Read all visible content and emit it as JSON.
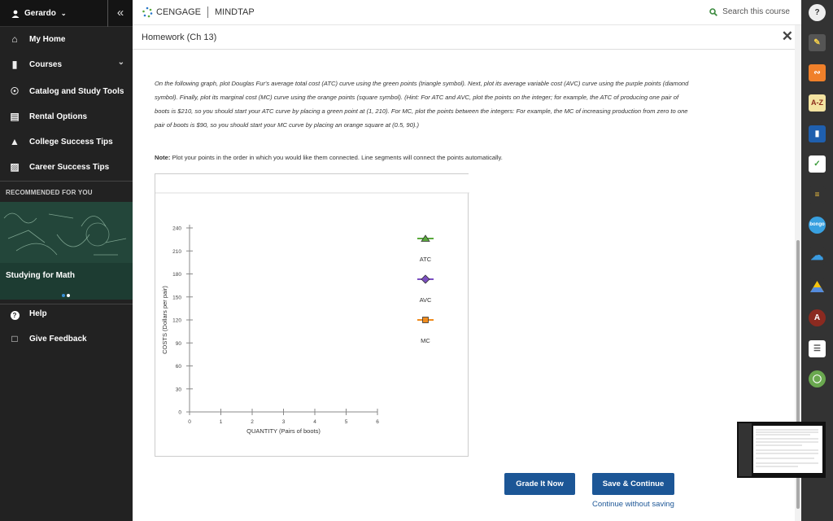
{
  "sidebar": {
    "user": "Gerardo",
    "collapse_icon": "«",
    "nav": [
      {
        "label": "My Home",
        "icon": "home-icon"
      },
      {
        "label": "Courses",
        "icon": "book-icon"
      },
      {
        "label": "Catalog and Study Tools",
        "icon": "compass-icon"
      },
      {
        "label": "Rental Options",
        "icon": "open-book-icon"
      },
      {
        "label": "College Success Tips",
        "icon": "graduation-cap-icon"
      },
      {
        "label": "Career Success Tips",
        "icon": "briefcase-icon"
      }
    ],
    "recommended_header": "RECOMMENDED FOR YOU",
    "recommended_title": "Studying for Math",
    "help": "Help",
    "feedback": "Give Feedback"
  },
  "topbar": {
    "brand": "CENGAGE",
    "product": "MINDTAP",
    "search_placeholder": "Search this course"
  },
  "assignment": {
    "title": "Homework (Ch 13)",
    "instructions": "On the following graph, plot Douglas Fur's average total cost (ATC) curve using the green points (triangle symbol). Next, plot its average variable cost (AVC) curve using the purple points (diamond symbol). Finally, plot its marginal cost (MC) curve using the orange points (square symbol). (Hint: For ATC and AVC, plot the points on the integer; for example, the ATC of producing one pair of boots is $210, so you should start your ATC curve by placing a green point at (1, 210). For MC, plot the points between the integers: For example, the MC of increasing production from zero to one pair of boots is $90, so you should start your MC curve by placing an orange square at (0.5, 90).)",
    "note_label": "Note:",
    "note_text": " Plot your points in the order in which you would like them connected. Line segments will connect the points automatically."
  },
  "chart_data": {
    "type": "scatter",
    "xlabel": "QUANTITY (Pairs of boots)",
    "ylabel": "COSTS (Dollars per pair)",
    "xlim": [
      0,
      6
    ],
    "ylim": [
      0,
      240
    ],
    "xticks": [
      0,
      1,
      2,
      3,
      4,
      5,
      6
    ],
    "yticks": [
      0,
      30,
      60,
      90,
      120,
      150,
      180,
      210,
      240
    ],
    "series": [],
    "legend_tools": [
      {
        "label": "ATC",
        "symbol": "triangle",
        "color": "#5aaa3c"
      },
      {
        "label": "AVC",
        "symbol": "diamond",
        "color": "#7b4fc0"
      },
      {
        "label": "MC",
        "symbol": "square",
        "color": "#f08c1e"
      }
    ],
    "help_symbol": "?"
  },
  "buttons": {
    "grade": "Grade It Now",
    "save": "Save & Continue",
    "continue": "Continue without saving"
  },
  "rightbar": {
    "atoz": "A-Z",
    "bongo": "bongo"
  },
  "colors": {
    "sidebar_bg": "#222222",
    "accent": "#1c5696"
  }
}
